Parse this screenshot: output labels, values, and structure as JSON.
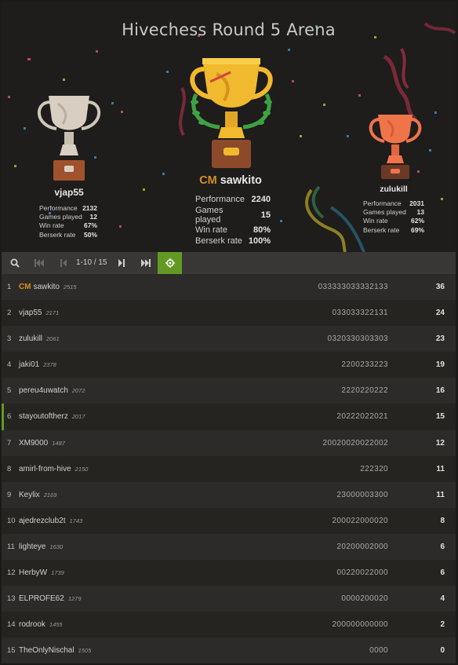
{
  "tournament": {
    "title": "Hivechess Round 5 Arena"
  },
  "podium": {
    "first": {
      "title": "CM",
      "name": "sawkito",
      "stats": [
        {
          "label": "Performance",
          "value": "2240"
        },
        {
          "label": "Games played",
          "value": "15"
        },
        {
          "label": "Win rate",
          "value": "80%"
        },
        {
          "label": "Berserk rate",
          "value": "100%"
        }
      ],
      "trophy_color": "#f1b92d"
    },
    "second": {
      "name": "vjap55",
      "stats": [
        {
          "label": "Performance",
          "value": "2132"
        },
        {
          "label": "Games played",
          "value": "12"
        },
        {
          "label": "Win rate",
          "value": "67%"
        },
        {
          "label": "Berserk rate",
          "value": "50%"
        }
      ],
      "trophy_color": "#d8cfc2"
    },
    "third": {
      "name": "zulukill",
      "stats": [
        {
          "label": "Performance",
          "value": "2031"
        },
        {
          "label": "Games played",
          "value": "13"
        },
        {
          "label": "Win rate",
          "value": "62%"
        },
        {
          "label": "Berserk rate",
          "value": "69%"
        }
      ],
      "trophy_color": "#f0744a"
    }
  },
  "toolbar": {
    "icons": [
      "search-icon",
      "first-page-icon",
      "previous-page-icon",
      "next-page-icon",
      "last-page-icon",
      "crosshair-icon"
    ],
    "pager": "1-10 / 15",
    "accent": "#629924"
  },
  "standings": [
    {
      "rank": "1",
      "title": "CM",
      "name": "sawkito",
      "rating": "2515",
      "sheet": "033333033332133",
      "score": "36"
    },
    {
      "rank": "2",
      "title": "",
      "name": "vjap55",
      "rating": "2171",
      "sheet": "033033322131",
      "score": "24"
    },
    {
      "rank": "3",
      "title": "",
      "name": "zulukill",
      "rating": "2061",
      "sheet": "0320330303303",
      "score": "23"
    },
    {
      "rank": "4",
      "title": "",
      "name": "jaki01",
      "rating": "2378",
      "sheet": "2200233223",
      "score": "19"
    },
    {
      "rank": "5",
      "title": "",
      "name": "pereu4uwatch",
      "rating": "2072",
      "sheet": "2220220222",
      "score": "16"
    },
    {
      "rank": "6",
      "title": "",
      "name": "stayoutoftherz",
      "rating": "2017",
      "sheet": "20222022021",
      "score": "15",
      "me": true
    },
    {
      "rank": "7",
      "title": "",
      "name": "XM9000",
      "rating": "1487",
      "sheet": "20020020022002",
      "score": "12"
    },
    {
      "rank": "8",
      "title": "",
      "name": "amirl-from-hive",
      "rating": "2150",
      "sheet": "222320",
      "score": "11"
    },
    {
      "rank": "9",
      "title": "",
      "name": "Keylix",
      "rating": "2169",
      "sheet": "23000003300",
      "score": "11"
    },
    {
      "rank": "10",
      "title": "",
      "name": "ajedrezclub2t",
      "rating": "1743",
      "sheet": "200022000020",
      "score": "8"
    },
    {
      "rank": "11",
      "title": "",
      "name": "lighteye",
      "rating": "1630",
      "sheet": "20200002000",
      "score": "6"
    },
    {
      "rank": "12",
      "title": "",
      "name": "HerbyW",
      "rating": "1739",
      "sheet": "00220022000",
      "score": "6"
    },
    {
      "rank": "13",
      "title": "",
      "name": "ELPROFE62",
      "rating": "1279",
      "sheet": "0000200020",
      "score": "4"
    },
    {
      "rank": "14",
      "title": "",
      "name": "rodrook",
      "rating": "1455",
      "sheet": "200000000000",
      "score": "2"
    },
    {
      "rank": "15",
      "title": "",
      "name": "TheOnlyNischal",
      "rating": "1505",
      "sheet": "0000",
      "score": "0"
    }
  ]
}
